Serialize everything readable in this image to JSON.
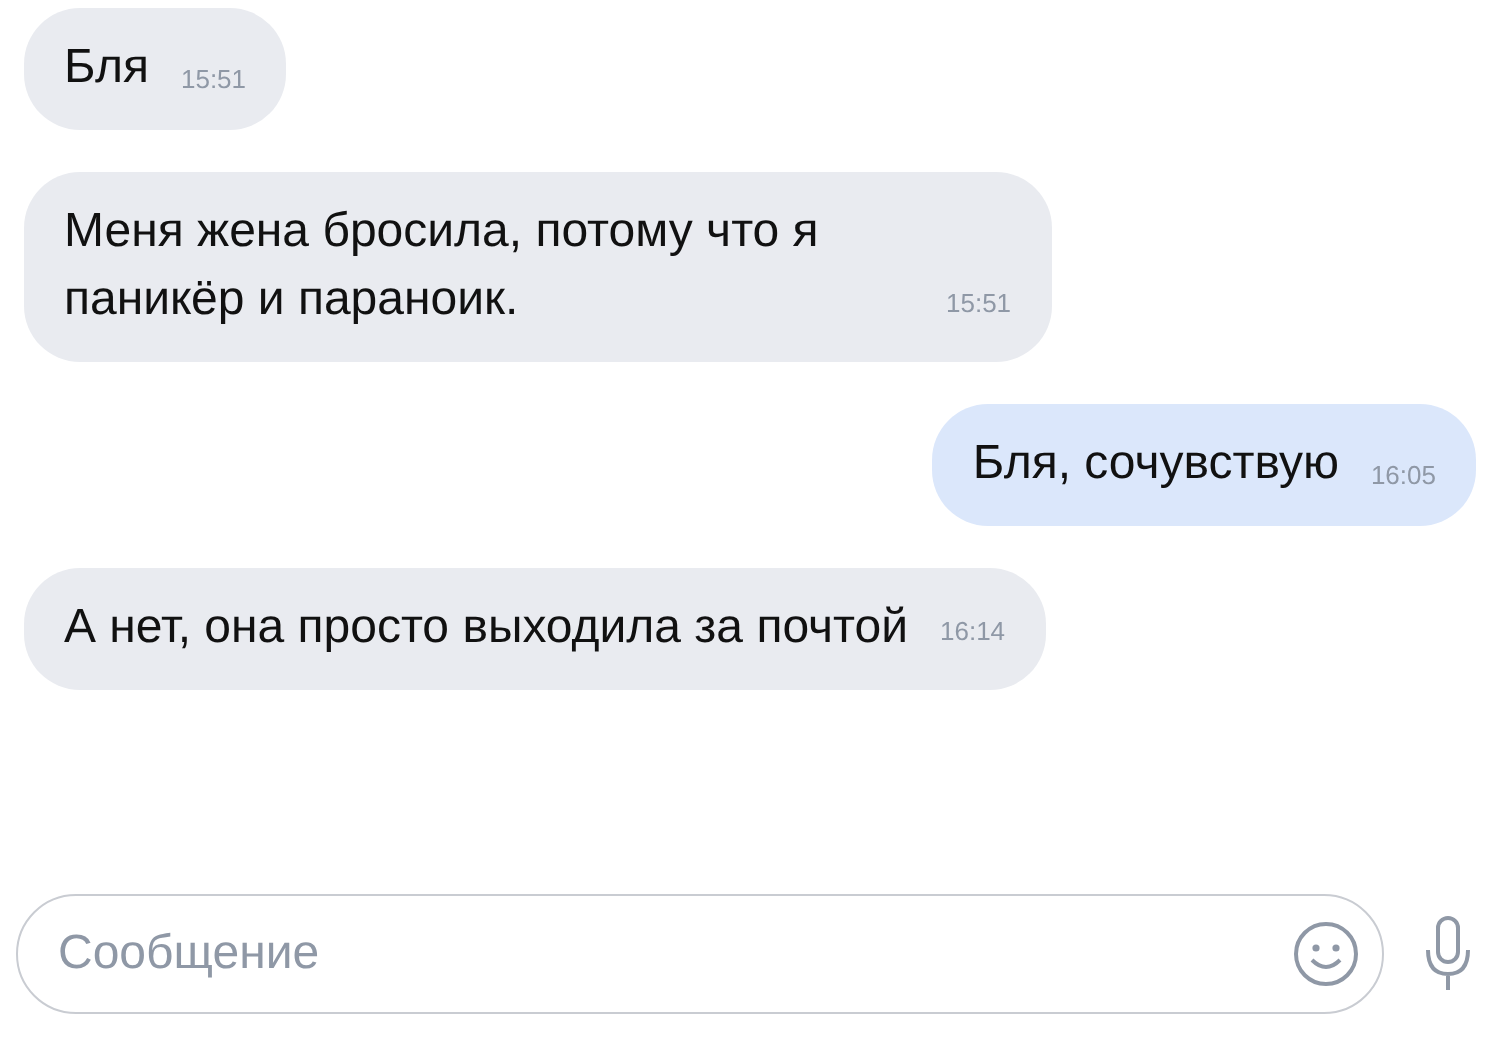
{
  "messages": [
    {
      "text": "Бля",
      "time": "15:51",
      "outgoing": false
    },
    {
      "text": "Меня жена бросила, потому что я паникёр и параноик.",
      "time": "15:51",
      "outgoing": false
    },
    {
      "text": "Бля, сочувствую",
      "time": "16:05",
      "outgoing": true
    },
    {
      "text": "А нет, она просто выходила за почтой",
      "time": "16:14",
      "outgoing": false
    }
  ],
  "composer": {
    "placeholder": "Сообщение"
  }
}
